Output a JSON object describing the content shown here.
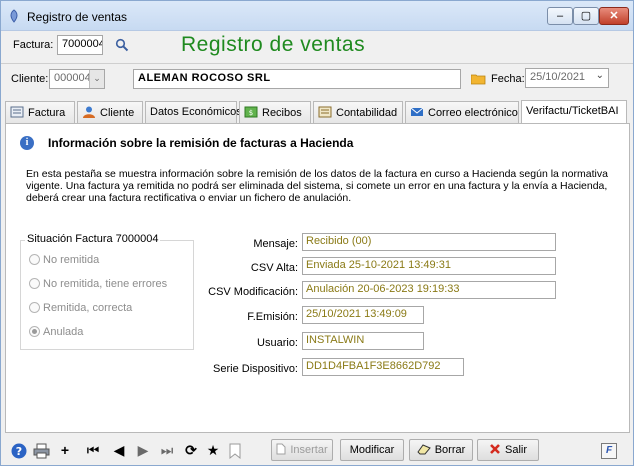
{
  "window": {
    "title": "Registro de ventas",
    "buttons": {
      "min": "–",
      "max": "▢",
      "close": "✕"
    }
  },
  "header": {
    "factura_label": "Factura:",
    "factura_value": "7000004",
    "big_title": "Registro de ventas",
    "cliente_label": "Cliente:",
    "cliente_code": "000004",
    "cliente_name": "ALEMAN ROCOSO SRL",
    "fecha_label": "Fecha:",
    "fecha_value": "25/10/2021"
  },
  "tabs": [
    {
      "label": "Factura",
      "icon": "document-icon"
    },
    {
      "label": "Cliente",
      "icon": "person-icon"
    },
    {
      "label": "Datos Económicos",
      "icon": ""
    },
    {
      "label": "Recibos",
      "icon": "receipt-icon"
    },
    {
      "label": "Contabilidad",
      "icon": "ledger-icon"
    },
    {
      "label": "Correo electrónico",
      "icon": "mail-icon"
    },
    {
      "label": "Verifactu/TicketBAI",
      "icon": "",
      "active": true
    }
  ],
  "panel": {
    "info_title": "Información sobre la remisión de facturas a Hacienda",
    "info_text": "En esta pestaña se muestra información sobre la remisión de los datos de la factura en curso a Hacienda según la normativa vigente. Una factura ya remitida no podrá ser eliminada del sistema, si comete un error en una factura y la envía a Hacienda, deberá crear una factura rectificativa o enviar un fichero de anulación.",
    "situacion": {
      "legend": "Situación Factura 7000004",
      "options": [
        "No remitida",
        "No remitida, tiene errores",
        "Remitida, correcta",
        "Anulada"
      ],
      "selected": "Anulada"
    },
    "details": {
      "mensaje_label": "Mensaje:",
      "mensaje": "Recibido (00)",
      "csv_alta_label": "CSV Alta:",
      "csv_alta": "Enviada 25-10-2021 13:49:31",
      "csv_mod_label": "CSV Modificación:",
      "csv_mod": "Anulación 20-06-2023 19:19:33",
      "emision_label": "F.Emisión:",
      "emision": "25/10/2021 13:49:09",
      "usuario_label": "Usuario:",
      "usuario": "INSTALWIN",
      "serie_label": "Serie Dispositivo:",
      "serie": "DD1D4FBA1F3E8662D792"
    }
  },
  "toolbar": {
    "insertar": "Insertar",
    "modificar": "Modificar",
    "borrar": "Borrar",
    "salir": "Salir",
    "plus": "+",
    "f_key": "F"
  },
  "colors": {
    "title_green": "#1f8a1f",
    "value_olive": "#8a7a16"
  }
}
